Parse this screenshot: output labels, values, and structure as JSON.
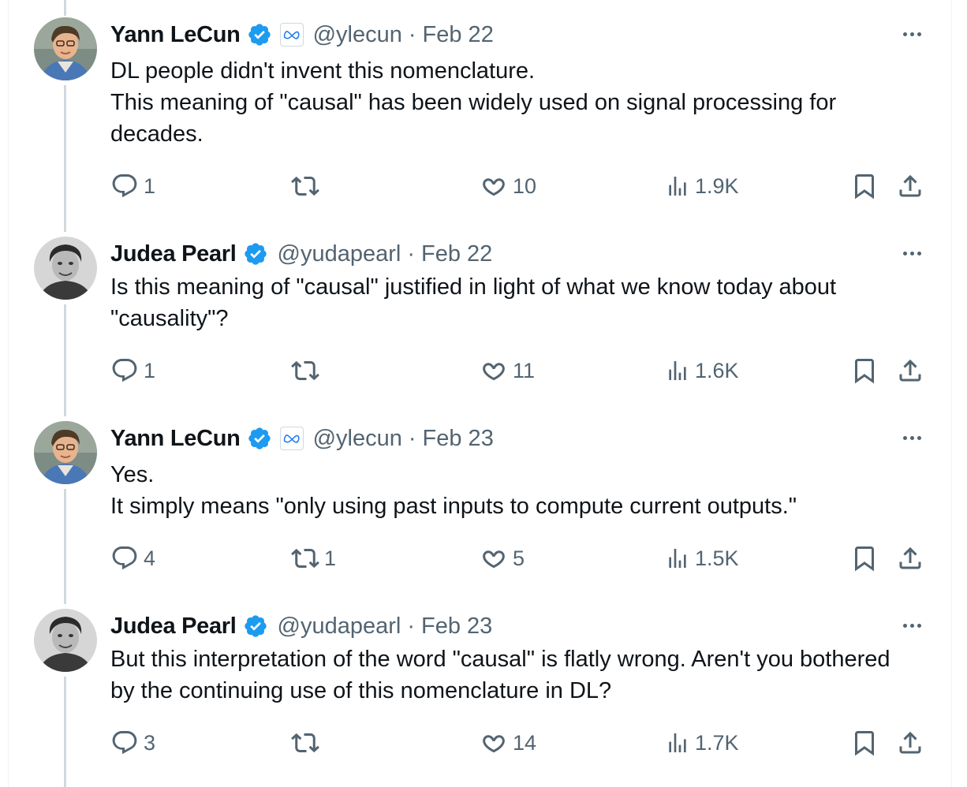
{
  "thread": [
    {
      "author": "Yann LeCun",
      "handle": "@ylecun",
      "separator": "·",
      "date": "Feb 22",
      "lines": [
        "DL people didn't invent this nomenclature.",
        "This meaning of \"causal\" has been widely used on signal processing for decades."
      ],
      "replies": "1",
      "retweets": "",
      "likes": "10",
      "views": "1.9K"
    },
    {
      "author": "Judea Pearl",
      "handle": "@yudapearl",
      "separator": "·",
      "date": "Feb 22",
      "lines": [
        "Is this meaning of \"causal\" justified in light of what we know today about \"causality\"?"
      ],
      "replies": "1",
      "retweets": "",
      "likes": "11",
      "views": "1.6K"
    },
    {
      "author": "Yann LeCun",
      "handle": "@ylecun",
      "separator": "·",
      "date": "Feb 23",
      "lines": [
        "Yes.",
        "It simply means \"only using past inputs to compute current outputs.\""
      ],
      "replies": "4",
      "retweets": "1",
      "likes": "5",
      "views": "1.5K"
    },
    {
      "author": "Judea Pearl",
      "handle": "@yudapearl",
      "separator": "·",
      "date": "Feb 23",
      "lines": [
        "But this interpretation of the word \"causal\" is flatly wrong. Aren't you bothered by the continuing use of this nomenclature in DL?"
      ],
      "replies": "3",
      "retweets": "",
      "likes": "14",
      "views": "1.7K"
    }
  ],
  "colors": {
    "text": "#0f1419",
    "secondary": "#536471",
    "verified": "#1d9bf0",
    "connector": "#cfd9de"
  },
  "icons": {
    "verified": "verified-badge-icon",
    "affiliate": "meta-affiliate-icon",
    "more": "more-icon",
    "reply": "reply-icon",
    "retweet": "retweet-icon",
    "like": "like-icon",
    "views": "views-icon",
    "bookmark": "bookmark-icon",
    "share": "share-icon"
  }
}
